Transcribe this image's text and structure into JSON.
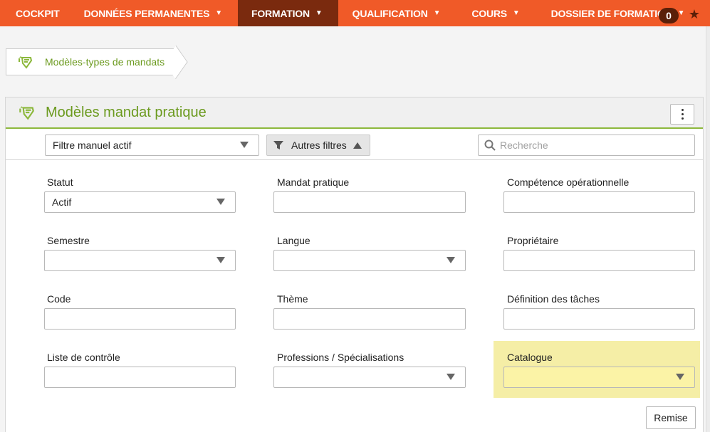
{
  "nav": {
    "items": [
      {
        "label": "COCKPIT",
        "caret": false,
        "active": false
      },
      {
        "label": "DONNÉES PERMANENTES",
        "caret": true,
        "active": false
      },
      {
        "label": "FORMATION",
        "caret": true,
        "active": true
      },
      {
        "label": "QUALIFICATION",
        "caret": true,
        "active": false
      },
      {
        "label": "COURS",
        "caret": true,
        "active": false
      },
      {
        "label": "DOSSIER DE FORMATION",
        "caret": true,
        "active": false
      }
    ],
    "caret_glyph": "▼",
    "badge_count": "0",
    "star_icon": "star-icon"
  },
  "breadcrumb": {
    "label": "Modèles-types de mandats p"
  },
  "panel": {
    "title": "Modèles mandat pratique",
    "filter_select_value": "Filtre manuel actif",
    "other_filters_label": "Autres filtres",
    "search_placeholder": "Recherche"
  },
  "fields": {
    "statut": {
      "label": "Statut",
      "value": "Actif"
    },
    "mandat_pratique": {
      "label": "Mandat pratique"
    },
    "competence": {
      "label": "Compétence opérationnelle"
    },
    "semestre": {
      "label": "Semestre"
    },
    "langue": {
      "label": "Langue"
    },
    "proprietaire": {
      "label": "Propriétaire"
    },
    "code": {
      "label": "Code"
    },
    "theme": {
      "label": "Thème"
    },
    "definition": {
      "label": "Définition des tâches"
    },
    "liste_controle": {
      "label": "Liste de contrôle"
    },
    "professions": {
      "label": "Professions / Spécialisations"
    },
    "catalogue": {
      "label": "Catalogue"
    }
  },
  "reset_label": "Remise",
  "colors": {
    "nav_bg": "#f05a28",
    "nav_active": "#7a2a0e",
    "accent_green": "#6b9a1e",
    "highlight_yellow": "#f5eea6"
  }
}
